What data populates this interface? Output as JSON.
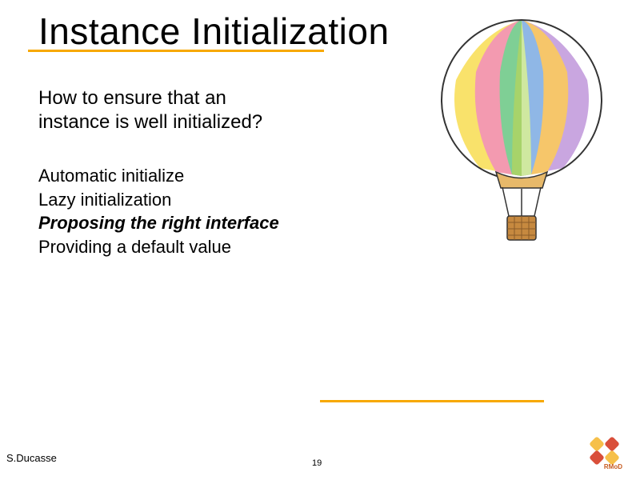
{
  "slide": {
    "title": "Instance Initialization",
    "subtitle_line1": "How to ensure that an",
    "subtitle_line2": "instance is well initialized?",
    "bullets": {
      "b1": "Automatic initialize",
      "b2": "Lazy initialization",
      "b3": "Proposing the right interface",
      "b4": "Providing a default value"
    },
    "author": "S.Ducasse",
    "page_number": "19",
    "logo_text": "RMoD"
  },
  "colors": {
    "accent": "#f7a800"
  }
}
